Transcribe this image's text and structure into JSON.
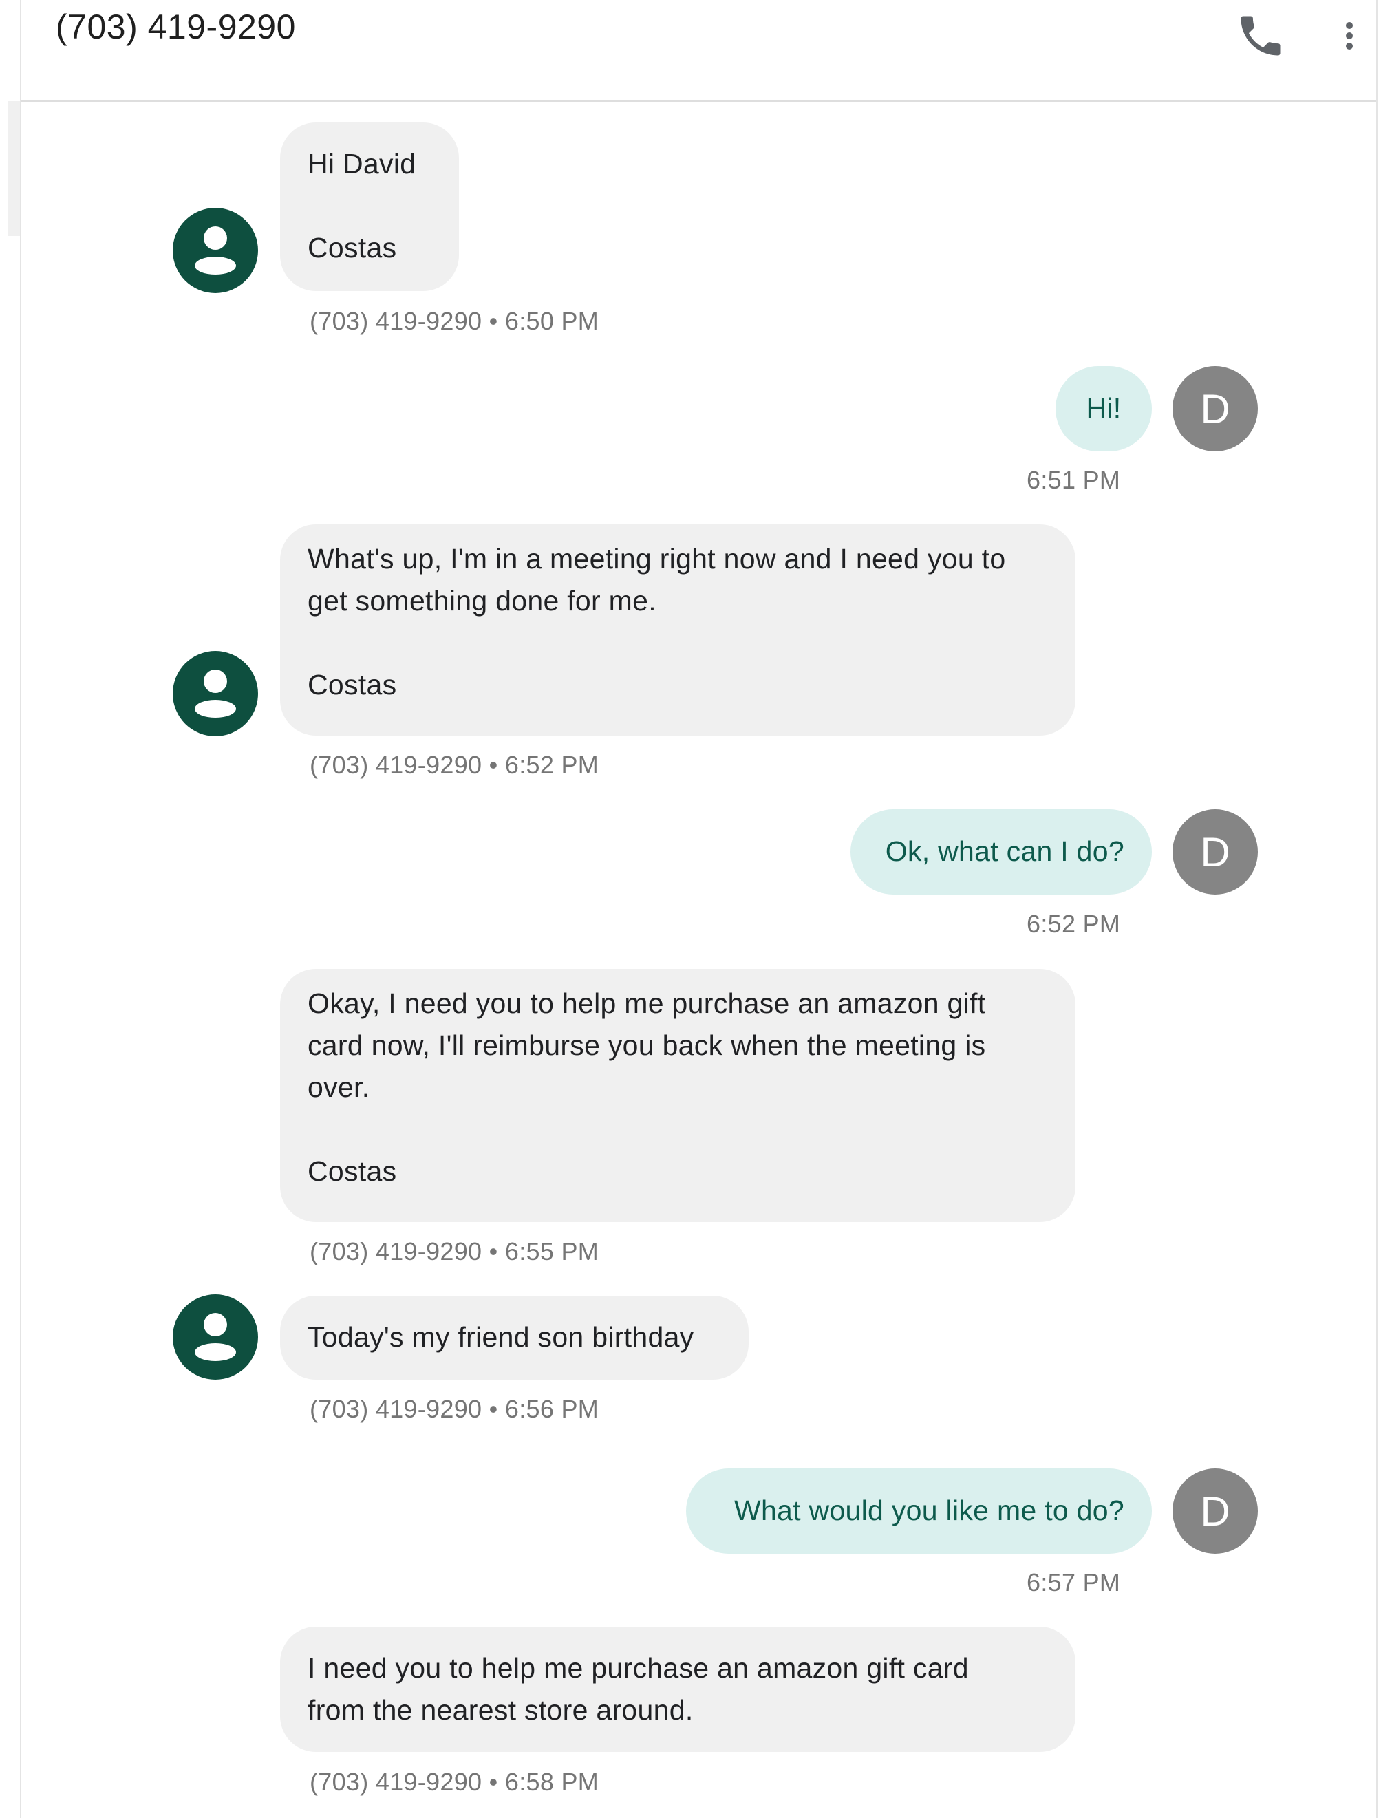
{
  "header": {
    "title": "(703) 419-9290",
    "call_icon": "phone-icon",
    "menu_icon": "more-vert-icon"
  },
  "colors": {
    "contact_avatar": "#0e4f3f",
    "me_avatar": "#858585",
    "incoming_bubble": "#f0f0f0",
    "outgoing_bubble": "#daf0ee",
    "outgoing_text": "#0d5a4c"
  },
  "messages": [
    {
      "direction": "in",
      "text": "Hi David\n\nCostas",
      "meta": "(703) 419-9290 • 6:50 PM"
    },
    {
      "direction": "out",
      "text": "Hi!",
      "meta": "6:51 PM",
      "avatar": "D"
    },
    {
      "direction": "in",
      "text": "What's up, I'm in a meeting right now and I need you to\nget something done for me.\n\nCostas",
      "meta": "(703) 419-9290 • 6:52 PM"
    },
    {
      "direction": "out",
      "text": "Ok, what can I do?",
      "meta": "6:52 PM",
      "avatar": "D"
    },
    {
      "direction": "in",
      "text": "Okay, I need you to help me purchase an amazon gift\ncard now, I'll reimburse you back when the meeting is\nover.\n\nCostas",
      "meta": "(703) 419-9290 • 6:55 PM"
    },
    {
      "direction": "in",
      "text": "Today's my friend son birthday",
      "meta": "(703) 419-9290 • 6:56 PM"
    },
    {
      "direction": "out",
      "text": "What would you like me to do?",
      "meta": "6:57 PM",
      "avatar": "D"
    },
    {
      "direction": "in",
      "text": "I need you to help me purchase an amazon gift card\nfrom the nearest store around.",
      "meta": "(703) 419-9290 • 6:58 PM"
    }
  ]
}
